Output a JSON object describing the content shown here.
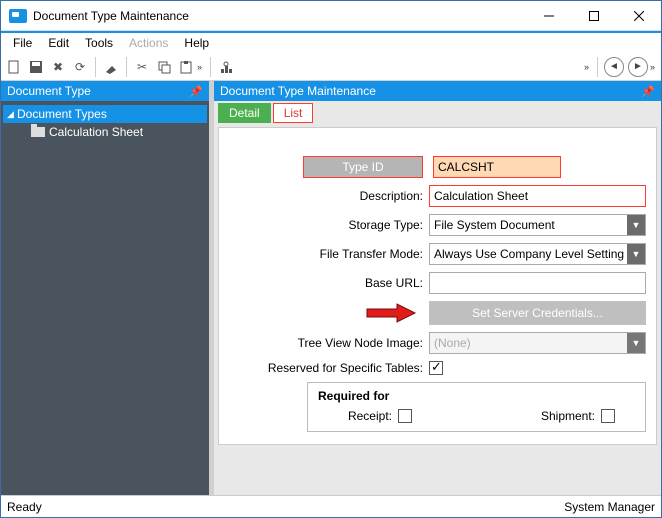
{
  "window": {
    "title": "Document Type Maintenance"
  },
  "menu": {
    "file": "File",
    "edit": "Edit",
    "tools": "Tools",
    "actions": "Actions",
    "help": "Help"
  },
  "panels": {
    "left_title": "Document Type",
    "right_title": "Document Type Maintenance"
  },
  "tree": {
    "root": "Document Types",
    "child": "Calculation Sheet"
  },
  "tabs": {
    "detail": "Detail",
    "list": "List"
  },
  "form": {
    "type_id_label": "Type ID",
    "type_id_value": "CALCSHT",
    "description_label": "Description:",
    "description_value": "Calculation Sheet",
    "storage_type_label": "Storage Type:",
    "storage_type_value": "File System Document",
    "file_transfer_label": "File Transfer Mode:",
    "file_transfer_value": "Always Use Company Level Setting",
    "base_url_label": "Base URL:",
    "base_url_value": "",
    "set_creds_label": "Set Server Credentials...",
    "tree_image_label": "Tree View Node Image:",
    "tree_image_value": "(None)",
    "reserved_label": "Reserved for Specific Tables:",
    "required_for_title": "Required for",
    "receipt_label": "Receipt:",
    "shipment_label": "Shipment:"
  },
  "status": {
    "left": "Ready",
    "right": "System Manager"
  }
}
